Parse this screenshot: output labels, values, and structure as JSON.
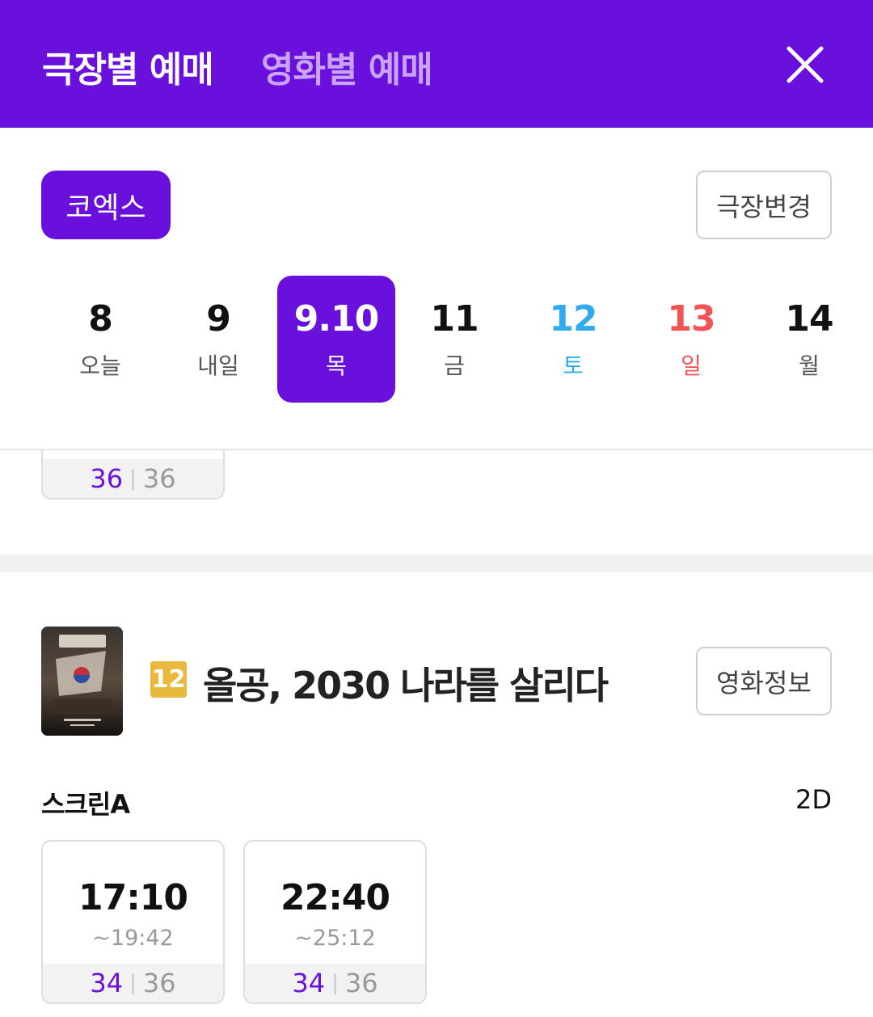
{
  "header": {
    "tab_theater": "극장별 예매",
    "tab_movie": "영화별 예매",
    "close_icon": "close-icon"
  },
  "theater": {
    "name": "코엑스",
    "change_label": "극장변경"
  },
  "dates": [
    {
      "num": "8",
      "day": "오늘"
    },
    {
      "num": "9",
      "day": "내일"
    },
    {
      "num": "9.10",
      "day": "목"
    },
    {
      "num": "11",
      "day": "금"
    },
    {
      "num": "12",
      "day": "토"
    },
    {
      "num": "13",
      "day": "일"
    },
    {
      "num": "14",
      "day": "월"
    }
  ],
  "colors": {
    "accent": "#6a10dc",
    "saturday": "#32aaee",
    "sunday": "#ef5555",
    "age_badge": "#e8b93a"
  },
  "prev_showtime": {
    "remaining": "36",
    "total": "36"
  },
  "movie": {
    "rating": "12",
    "title": "올공, 2030 나라를 살리다",
    "info_label": "영화정보",
    "poster_icon": "movie-poster-image"
  },
  "screen": {
    "name": "스크린A",
    "format": "2D",
    "showtimes": [
      {
        "start": "17:10",
        "end": "~19:42",
        "remaining": "34",
        "total": "36"
      },
      {
        "start": "22:40",
        "end": "~25:12",
        "remaining": "34",
        "total": "36"
      }
    ]
  }
}
